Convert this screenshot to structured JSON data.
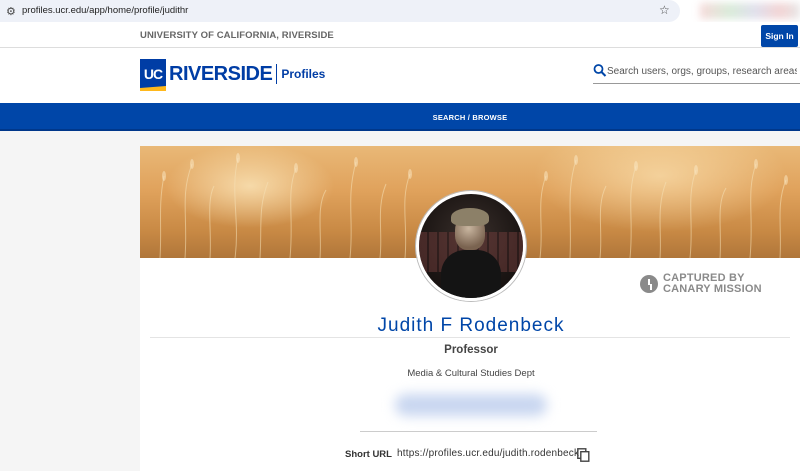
{
  "browser": {
    "url": "profiles.ucr.edu/app/home/profile/judithr",
    "site_icon": "site-settings-icon",
    "bookmark_icon": "star-icon"
  },
  "header": {
    "university": "UNIVERSITY OF CALIFORNIA, RIVERSIDE",
    "sign_in": "Sign In",
    "logo": {
      "uc": "UC",
      "riverside": "RIVERSIDE",
      "product": "Profiles"
    },
    "search_placeholder": "Search users, orgs, groups, research areas"
  },
  "nav": {
    "link": "SEARCH / BROWSE"
  },
  "profile": {
    "name": "Judith F Rodenbeck",
    "title": "Professor",
    "department": "Media & Cultural Studies Dept",
    "short_url_label": "Short URL",
    "short_url": "https://profiles.ucr.edu/judith.rodenbeck"
  },
  "watermark": {
    "line1": "CAPTURED BY",
    "line2": "CANARY MISSION"
  },
  "colors": {
    "brand_blue": "#0046a8",
    "accent_gold": "#ffb81c"
  }
}
